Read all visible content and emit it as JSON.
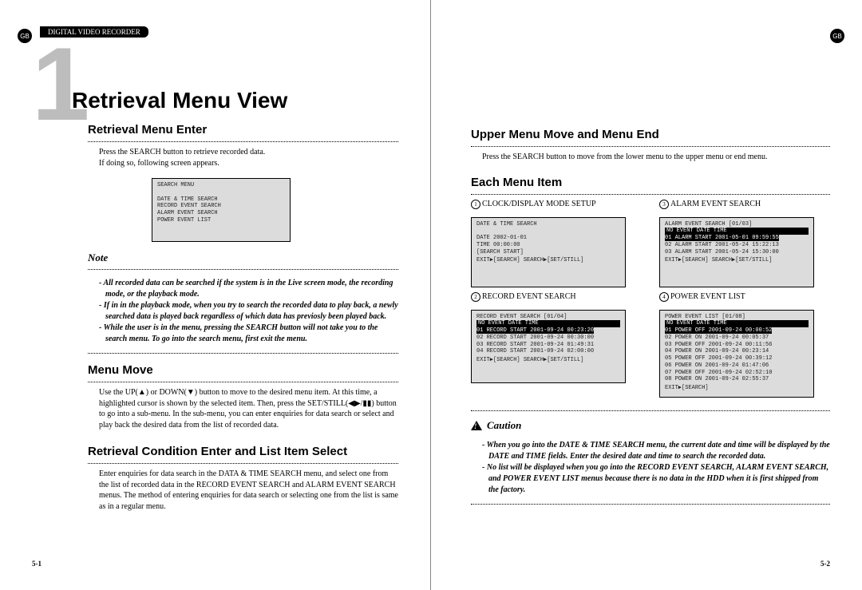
{
  "gb": "GB",
  "header_tab": "DIGITAL VIDEO RECORDER",
  "chapter_num": "1",
  "title": "Retrieval Menu View",
  "left": {
    "s1": {
      "h": "Retrieval Menu Enter",
      "p1": "Press the SEARCH button to retrieve recorded data.",
      "p2": "If doing so, following screen appears."
    },
    "search_menu": {
      "title": "SEARCH MENU",
      "items": [
        "DATE & TIME SEARCH",
        "RECORD EVENT SEARCH",
        "ALARM EVENT SEARCH",
        "POWER EVENT LIST"
      ]
    },
    "note_label": "Note",
    "notes": [
      "All recorded data can be searched if the system is in the Live screen mode, the recording mode, or the playback mode.",
      "If in in the playback mode, when you try to search the recorded data to play back, a newly searched data is played back regardless of which data has previosly been played back.",
      "While the user is in the menu, pressing the SEARCH button will not take you to the search menu. To go into the search menu, first exit the menu."
    ],
    "s2": {
      "h": "Menu Move",
      "p": "Use the UP(▲) or DOWN(▼) button to move to the desired menu item. At this time, a highlighted cursor is shown by the selected item. Then, press the SET/STILL(◀▶/▮▮) button to go into a sub-menu. In the sub-menu, you can enter enquiries for data search or select and play back the desired data from the list of recorded data."
    },
    "s3": {
      "h": "Retrieval Condition Enter and List Item Select",
      "p": "Enter enquiries for data search in the DATA & TIME SEARCH menu, and select one from the list of recorded data in the RECORD EVENT SEARCH and ALARM EVENT SEARCH menus. The method of entering enquiries for data search or selecting one from the list is same as in a regular menu."
    },
    "footer": "5-1"
  },
  "right": {
    "s1": {
      "h": "Upper Menu Move and Menu End",
      "p": "Press the SEARCH button to move from the lower menu to the upper menu or end menu."
    },
    "s2": {
      "h": "Each Menu Item"
    },
    "items": {
      "i1": {
        "n": "1",
        "label": "CLOCK/DISPLAY MODE SETUP",
        "screen": {
          "title": "DATE & TIME SEARCH",
          "rows": [
            "DATE          2002-01-01",
            "TIME           00:00:00",
            "[SEARCH START]"
          ],
          "footer": "EXIT▶[SEARCH] SEARCH▶[SET/STILL]"
        }
      },
      "i3": {
        "n": "3",
        "label": "ALARM EVENT SEARCH",
        "screen": {
          "title": "ALARM EVENT SEARCH     [01/03]",
          "hdr": "NO  EVENT        DATE     TIME",
          "hl": "01 ALARM START 2001-05-01 09:59:55",
          "rows": [
            "02 ALARM START 2001-05-24 15:22:13",
            "03 ALARM START 2001-05-24 15:30:00"
          ],
          "footer": "EXIT▶[SEARCH] SEARCH▶[SET/STILL]"
        }
      },
      "i2": {
        "n": "2",
        "label": "RECORD EVENT SEARCH",
        "screen": {
          "title": "RECORD EVENT SEARCH    [01/04]",
          "hdr": "NO  EVENT        DATE     TIME",
          "hl": "01 RECORD START 2001-09-24 00:23:20",
          "rows": [
            "02 RECORD START 2001-09-24 00:30:00",
            "03 RECORD START 2001-09-24 01:49:31",
            "04 RECORD START 2001-09-24 02:00:00"
          ],
          "footer": "EXIT▶[SEARCH] SEARCH▶[SET/STILL]"
        }
      },
      "i4": {
        "n": "4",
        "label": "POWER EVENT LIST",
        "screen": {
          "title": "POWER EVENT LIST       [01/08]",
          "hdr": "NO  EVENT      DATE      TIME",
          "hl": "01  POWER OFF  2001-09-24  00:00:52",
          "rows": [
            "02  POWER ON   2001-09-24  00:05:37",
            "03  POWER OFF  2001-09-24  00:11:56",
            "04  POWER ON   2001-09-24  00:23:14",
            "05  POWER OFF  2001-09-24  00:39:12",
            "06  POWER ON   2001-09-24  01:47:06",
            "07  POWER OFF  2001-09-24  02:52:10",
            "08  POWER ON   2001-09-24  02:55:37"
          ],
          "footer": "EXIT▶[SEARCH]"
        }
      }
    },
    "caution_label": "Caution",
    "cautions": [
      "When you go into the DATE & TIME SEARCH menu, the current date and time will be displayed by the DATE and TIME fields. Enter the desired date and time to search the recorded data.",
      "No list will be displayed when you go into the RECORD EVENT SEARCH, ALARM EVENT SEARCH, and POWER EVENT LIST menus because there is no data in the HDD when it is first shipped from the factory."
    ],
    "footer": "5-2"
  }
}
